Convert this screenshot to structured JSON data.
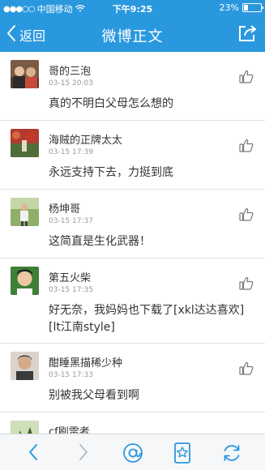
{
  "status_bar": {
    "carrier": "中国移动",
    "time": "下午9:25",
    "battery_percent": "23%",
    "battery_level": 0.23
  },
  "nav": {
    "back_label": "返回",
    "title": "微博正文"
  },
  "comments": [
    {
      "name": "哥的三泡",
      "time": "03-15 20:03",
      "text": "真的不明白父母怎么想的"
    },
    {
      "name": "海贼的正牌太太",
      "time": "03-15 17:39",
      "text": "永远支持下去，力挺到底"
    },
    {
      "name": "杨坤哥",
      "time": "03-15 17:37",
      "text": "这简直是生化武器！"
    },
    {
      "name": "第五火柴",
      "time": "03-15 17:35",
      "text": "好无奈，我妈妈也下载了[xkl达达喜欢][lt江南style]"
    },
    {
      "name": "酣睡黑描稀少种",
      "time": "03-15 17:33",
      "text": "别被我父母看到啊"
    },
    {
      "name": "cf刷雷者",
      "time": "",
      "text": ""
    }
  ],
  "colors": {
    "header_blue": "#2a98de",
    "icon_blue": "#2a98de"
  },
  "icons": [
    "back-chevron-icon",
    "share-icon",
    "thumbs-up-icon",
    "at-mention-icon",
    "favorite-star-icon",
    "refresh-icon"
  ]
}
